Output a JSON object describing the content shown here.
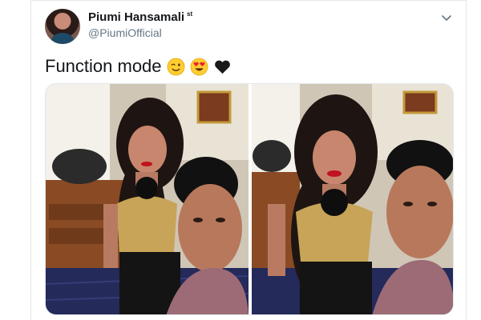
{
  "tweet": {
    "author_name": "Piumi Hansamali",
    "author_badge": "st",
    "handle": "@PiumiOfficial",
    "text": "Function mode",
    "emojis": [
      "winking-face",
      "heart-eyes-face",
      "black-heart"
    ],
    "media_count": 2
  },
  "colors": {
    "text": "#14171a",
    "secondary": "#657786",
    "border": "#e1e8ed"
  }
}
